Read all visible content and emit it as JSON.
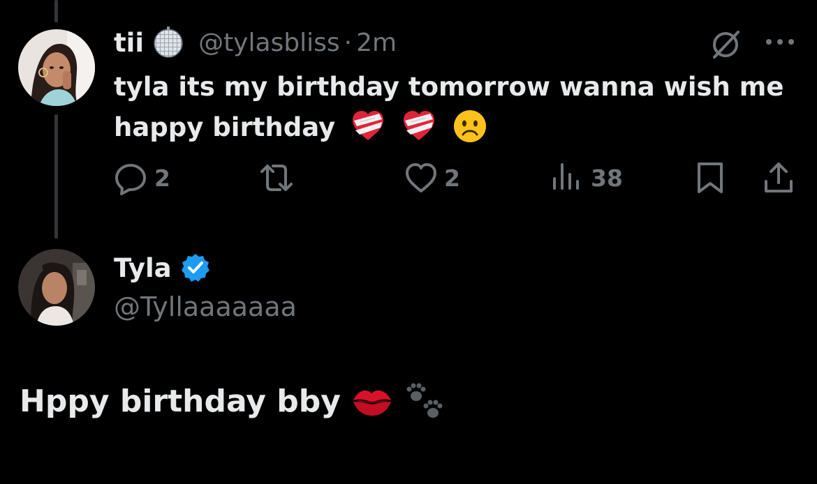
{
  "tweet": {
    "author_name": "tii",
    "author_handle": "@tylasbliss",
    "separator": "·",
    "time": "2m",
    "text": "tyla its my birthday tomorrow wanna wish me happy birthday",
    "text_emojis": [
      "heart-with-bandage",
      "heart-with-bandage",
      "slightly-frowning-face"
    ],
    "actions": {
      "reply_count": "2",
      "retweet_count": "",
      "like_count": "2",
      "view_count": "38"
    }
  },
  "reply": {
    "author_name": "Tyla",
    "verified": true,
    "author_handle": "@Tyllaaaaaaa",
    "text": "Hppy birthday bby",
    "text_emojis": [
      "kiss-mark",
      "paw-prints"
    ]
  },
  "colors": {
    "background": "#000000",
    "primary_text": "#e7e9ea",
    "secondary_text": "#71767b",
    "verified_blue": "#1d9bf0",
    "thread_line": "#333639"
  }
}
